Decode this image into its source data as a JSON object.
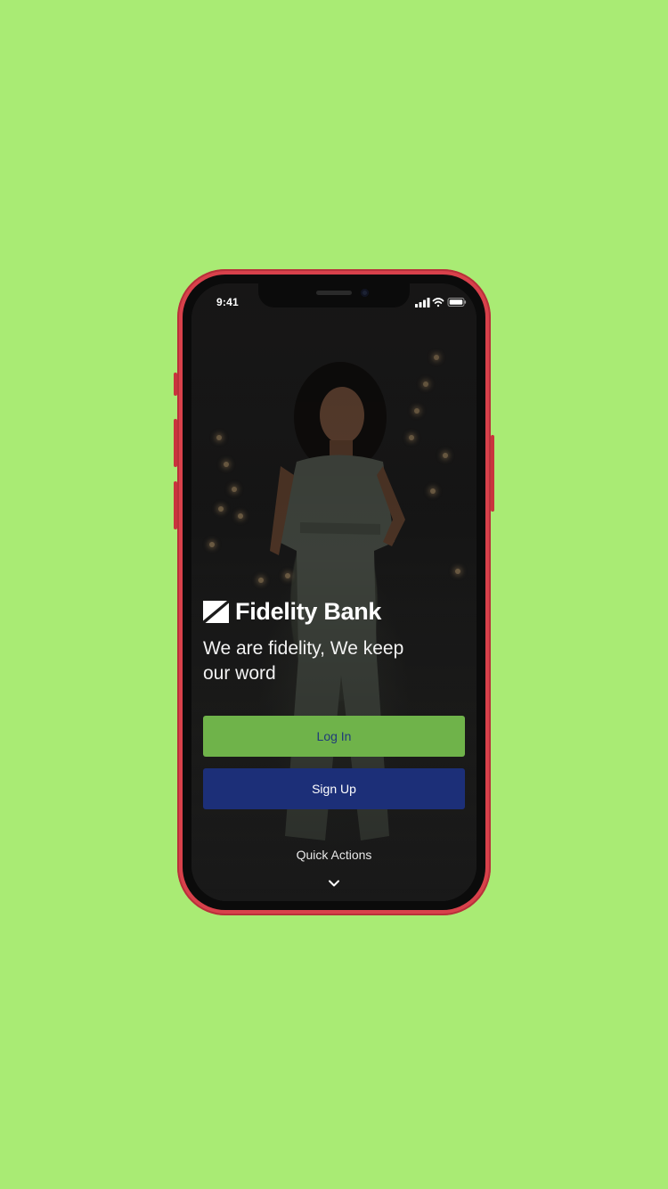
{
  "status_bar": {
    "time": "9:41",
    "signal_icon": "cellular-signal-icon",
    "wifi_icon": "wifi-icon",
    "battery_icon": "battery-icon"
  },
  "brand": {
    "logo_icon": "fidelity-logo-icon",
    "name": "Fidelity Bank"
  },
  "tagline": "We are fidelity, We keep our word",
  "buttons": {
    "login_label": "Log In",
    "signup_label": "Sign Up"
  },
  "quick_actions": {
    "label": "Quick Actions",
    "icon": "chevron-down-icon"
  },
  "colors": {
    "page_background": "#a9eb74",
    "phone_frame": "#d8414b",
    "login_button": "#6fb34a",
    "login_text": "#1f3a7a",
    "signup_button": "#1c2f78",
    "signup_text": "#ffffff"
  }
}
